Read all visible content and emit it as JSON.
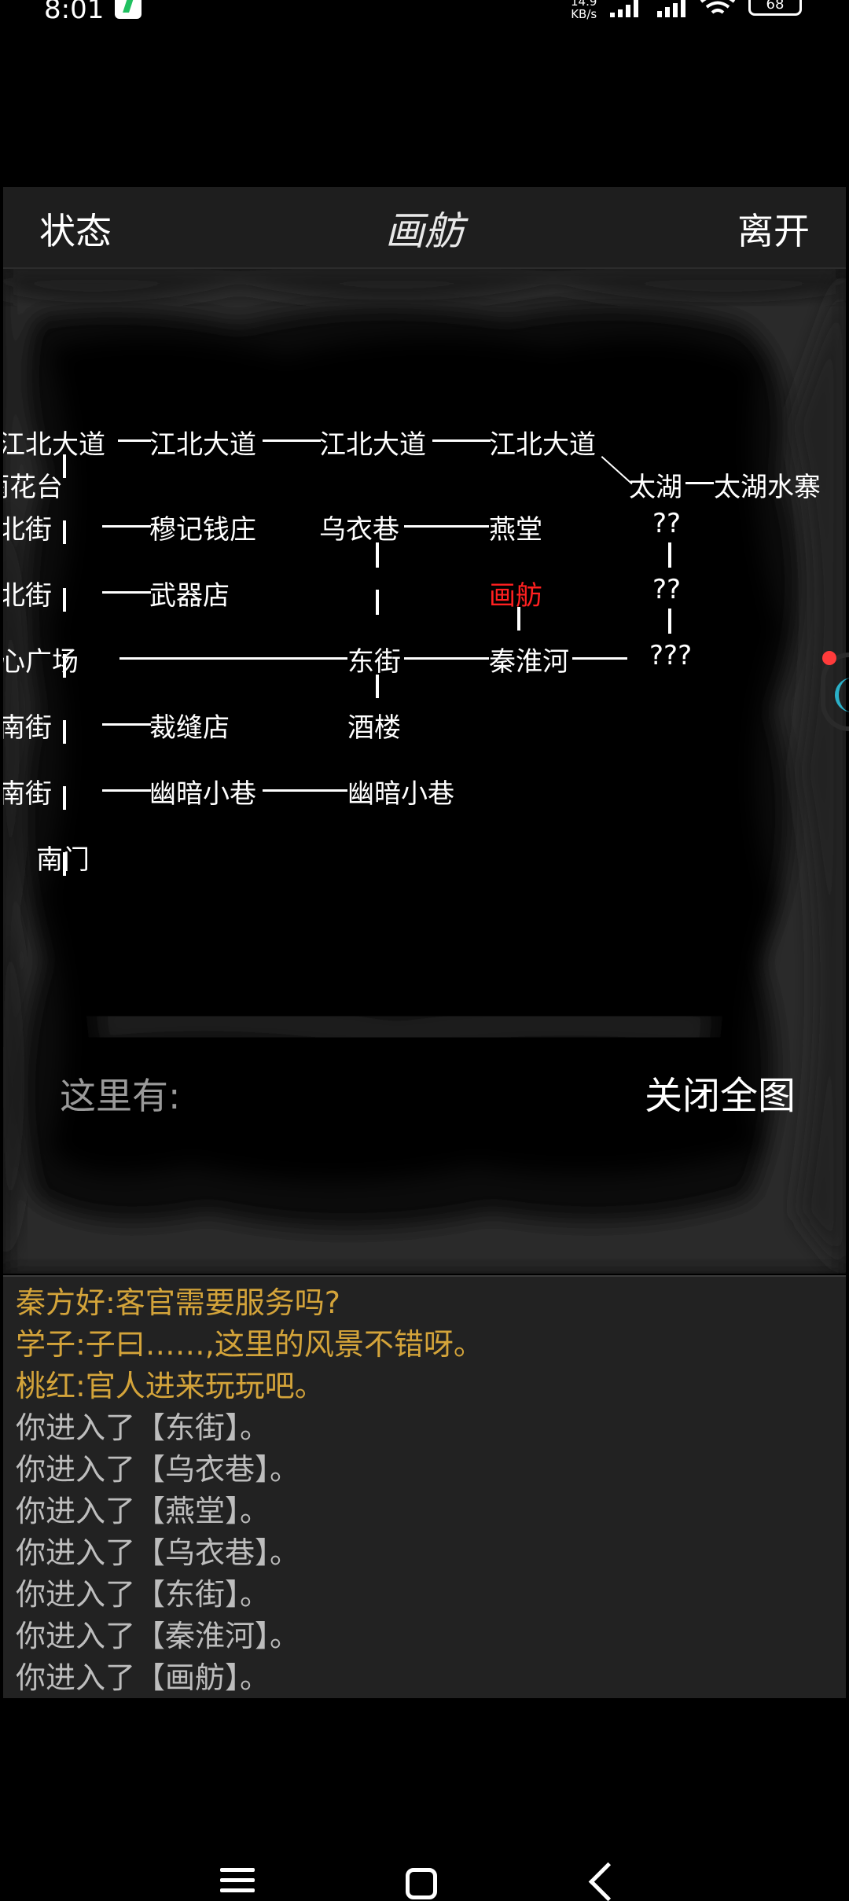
{
  "status_bar": {
    "time": "8:01",
    "net_speed_value": "14.9",
    "net_speed_unit": "KB/s",
    "battery": "68",
    "icons": [
      "charging-icon",
      "signal-icon",
      "hd-signal-icon",
      "wifi-icon",
      "battery-icon"
    ]
  },
  "header": {
    "status_label": "状态",
    "title": "画舫",
    "leave_label": "离开"
  },
  "map": {
    "nodes": {
      "jiangbei1": "江北大道",
      "jiangbei2": "江北大道",
      "jiangbei3": "江北大道",
      "jiangbei4": "江北大道",
      "yuhuatai": "雨花台",
      "taihu": "太湖",
      "taihu_shuizhai": "太湖水寨",
      "beijie1": "北街",
      "muji": "穆记钱庄",
      "wuyixiang": "乌衣巷",
      "yantang": "燕堂",
      "unknown1": "??",
      "beijie2": "北街",
      "wuqidian": "武器店",
      "huafang": "画舫",
      "unknown2": "??",
      "center": "中心广场",
      "dongjie": "东街",
      "qinhuaihe": "秦淮河",
      "unknown3": "???",
      "nanjie1": "南街",
      "caifengdian": "裁缝店",
      "jiulou": "酒楼",
      "nanjie2": "南街",
      "youan1": "幽暗小巷",
      "youan2": "幽暗小巷",
      "nanmen": "南门"
    },
    "current_location": "画舫",
    "current_color": "#ff2020"
  },
  "here": {
    "label": "这里有:"
  },
  "close_map_label": "关闭全图",
  "log": {
    "lines": [
      {
        "text": "秦方好:客官需要服务吗?",
        "kind": "npc"
      },
      {
        "text": "学子:子曰……,这里的风景不错呀。",
        "kind": "npc"
      },
      {
        "text": "桃红:官人进来玩玩吧。",
        "kind": "npc"
      },
      {
        "text": "你进入了【东街】。",
        "kind": "sys"
      },
      {
        "text": "你进入了【乌衣巷】。",
        "kind": "sys"
      },
      {
        "text": "你进入了【燕堂】。",
        "kind": "sys"
      },
      {
        "text": "你进入了【乌衣巷】。",
        "kind": "sys"
      },
      {
        "text": "你进入了【东街】。",
        "kind": "sys"
      },
      {
        "text": "你进入了【秦淮河】。",
        "kind": "sys"
      },
      {
        "text": "你进入了【画舫】。",
        "kind": "sys"
      }
    ],
    "npc_color": "#d4a43a",
    "sys_color": "#bdbdbd"
  },
  "nav": {
    "icons": [
      "menu-icon",
      "home-icon",
      "back-icon"
    ]
  }
}
